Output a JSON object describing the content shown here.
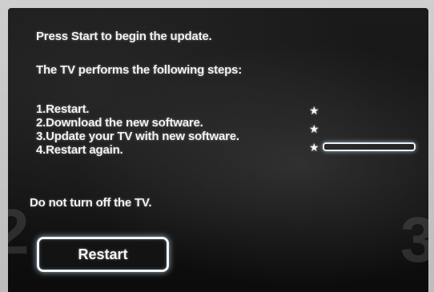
{
  "dialog": {
    "line1": "Press Start to begin the update.",
    "line2": "The TV performs the following steps:",
    "steps": [
      {
        "label": "1.Restart.",
        "status_icon": "star"
      },
      {
        "label": "2.Download the new software.",
        "status_icon": "star"
      },
      {
        "label": "3.Update your TV with new software.",
        "status_icon": "star"
      },
      {
        "label": "4.Restart again."
      }
    ],
    "warning": "Do not turn off the TV.",
    "restart_button": "Restart",
    "background_numbers": {
      "left": "2",
      "right": "3"
    }
  },
  "progress": {
    "value": 0
  }
}
